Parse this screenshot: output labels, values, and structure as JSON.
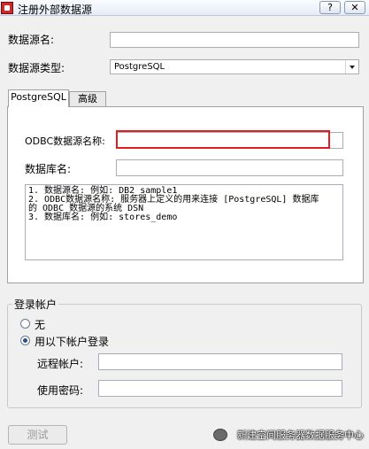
{
  "window": {
    "title": "注册外部数据源",
    "help_btn": "?",
    "close_btn": "✕"
  },
  "form": {
    "ds_name_label": "数据源名:",
    "ds_name_value": "",
    "ds_type_label": "数据源类型:",
    "ds_type_value": "PostgreSQL"
  },
  "tabs": [
    "PostgreSQL",
    "高级"
  ],
  "postgres": {
    "odbc_label": "ODBC数据源名称:",
    "odbc_value": "",
    "db_label": "数据库名:",
    "db_value": "",
    "help_lines": [
      "1. 数据源名:       例如: DB2_sample1",
      "2. ODBC数据源名称:    服务器上定义的用来连接 [PostgreSQL] 数据库",
      "的 ODBC 数据源的系统 DSN",
      "3. 数据库名:        例如: stores_demo"
    ]
  },
  "login": {
    "group_label": "登录帐户",
    "option_none": "无",
    "option_account": "用以下帐户登录",
    "selected": "用以下帐户登录",
    "remote_label": "远程帐户:",
    "remote_value": "",
    "password_label": "使用密码:",
    "password_value": ""
  },
  "buttons": {
    "test": "测试"
  },
  "watermark": "新建空间服务器数据服务中心",
  "colors": {
    "highlight_border": "#e01e1e",
    "title_bar": "#e4ecf6"
  }
}
